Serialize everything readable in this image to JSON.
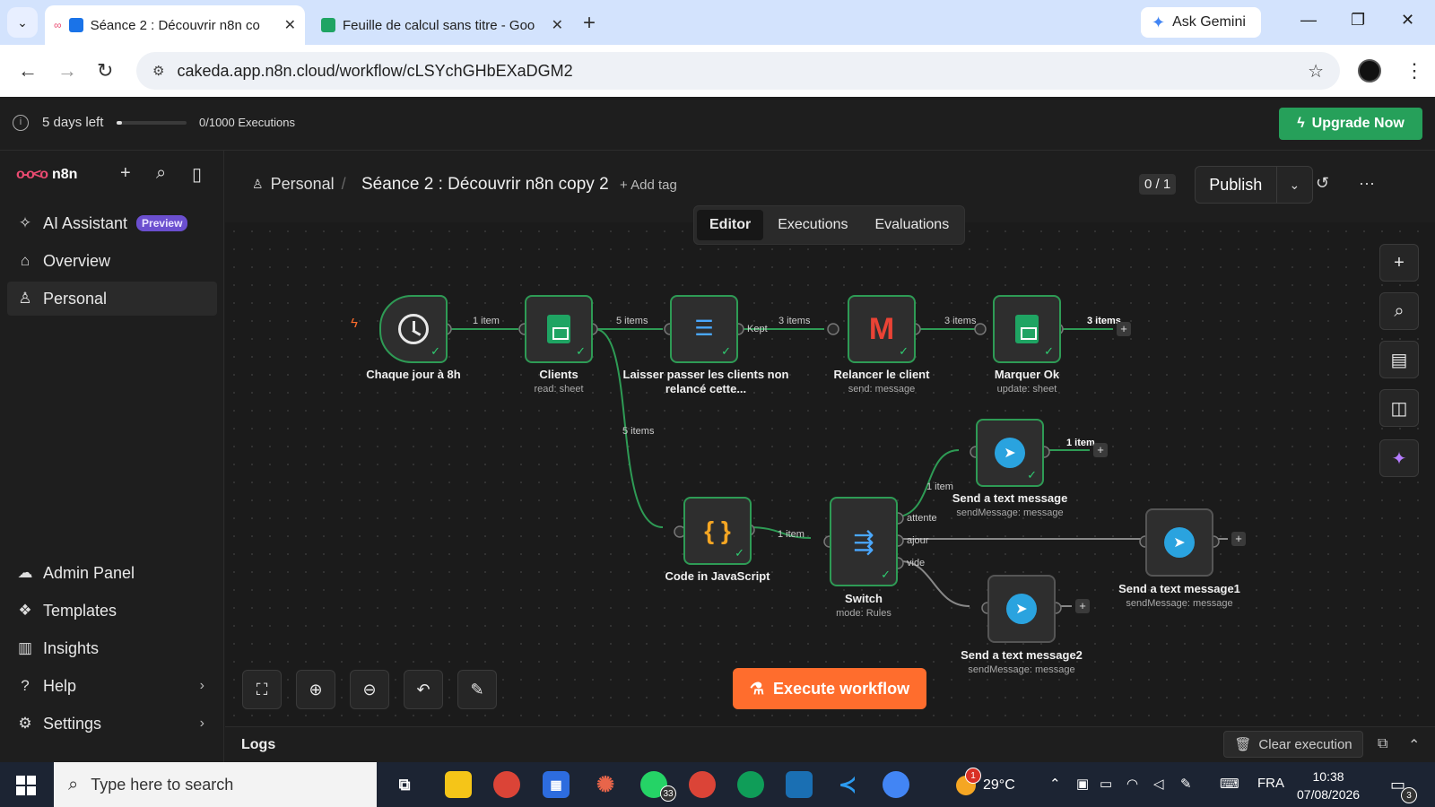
{
  "browser": {
    "tabs": [
      {
        "title": "Séance 2 : Découvrir n8n co",
        "active": true
      },
      {
        "title": "Feuille de calcul sans titre - Goo",
        "active": false
      }
    ],
    "gemini_label": "Ask Gemini",
    "url": "cakeda.app.n8n.cloud/workflow/cLSYchGHbEXaDGM2"
  },
  "trial": {
    "days_left": "5 days left",
    "executions": "0/1000 Executions",
    "usage_fraction": 0.0,
    "upgrade_label": "Upgrade Now"
  },
  "sidebar": {
    "logo_text": "n8n",
    "items_top": [
      {
        "label": "AI Assistant",
        "badge": "Preview",
        "icon": "sparkle-icon"
      },
      {
        "label": "Overview",
        "icon": "home-icon"
      },
      {
        "label": "Personal",
        "icon": "user-icon",
        "selected": true
      }
    ],
    "items_bottom": [
      {
        "label": "Admin Panel",
        "icon": "cloud-icon"
      },
      {
        "label": "Templates",
        "icon": "box-icon"
      },
      {
        "label": "Insights",
        "icon": "chart-icon"
      },
      {
        "label": "Help",
        "icon": "help-icon",
        "chevron": true
      },
      {
        "label": "Settings",
        "icon": "gear-icon",
        "chevron": true
      }
    ]
  },
  "header": {
    "breadcrumb": "Personal",
    "workflow_name": "Séance 2 : Découvrir n8n copy 2",
    "add_tag": "+ Add tag",
    "counter": "0 / 1",
    "publish_label": "Publish"
  },
  "view_tabs": [
    {
      "label": "Editor",
      "active": true
    },
    {
      "label": "Executions",
      "active": false
    },
    {
      "label": "Evaluations",
      "active": false
    }
  ],
  "nodes": {
    "trigger": {
      "label": "Chaque jour à 8h",
      "sub": ""
    },
    "clients": {
      "label": "Clients",
      "sub": "read: sheet"
    },
    "filter": {
      "label": "Laisser passer les clients non relancé cette...",
      "sub": ""
    },
    "gmail": {
      "label": "Relancer le client",
      "sub": "send: message"
    },
    "mark": {
      "label": "Marquer Ok",
      "sub": "update: sheet"
    },
    "code": {
      "label": "Code in JavaScript",
      "sub": ""
    },
    "switch": {
      "label": "Switch",
      "sub": "mode: Rules"
    },
    "tg1": {
      "label": "Send a text message",
      "sub": "sendMessage: message"
    },
    "tg2": {
      "label": "Send a text message1",
      "sub": "sendMessage: message"
    },
    "tg3": {
      "label": "Send a text message2",
      "sub": "sendMessage: message"
    }
  },
  "edges": {
    "e1": "1 item",
    "e2": "5 items",
    "e3_kept": "Kept",
    "e3": "3 items",
    "e4": "3 items",
    "e5": "3 items",
    "e6": "5 items",
    "e7": "1 item",
    "e8": "1 item",
    "e9": "1 item",
    "out_attente": "attente",
    "out_ajour": "ajour",
    "out_vide": "vide"
  },
  "execute_label": "Execute workflow",
  "logs": {
    "title": "Logs",
    "clear_label": "Clear execution"
  },
  "taskbar": {
    "search_placeholder": "Type here to search",
    "whatsapp_badge": "33",
    "weather": "29°C",
    "weather_badge": "1",
    "lang": "FRA",
    "time": "10:38",
    "date": "07/08/2026",
    "notif_count": "3"
  },
  "colors": {
    "accent": "#ff6d2d",
    "success": "#2e9b55",
    "upgrade": "#26a05a"
  }
}
